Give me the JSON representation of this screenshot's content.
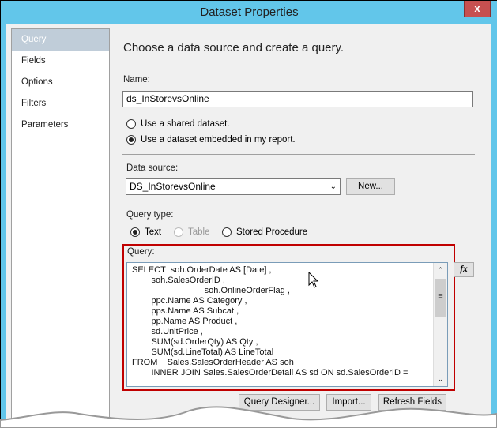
{
  "window": {
    "title": "Dataset Properties",
    "close_label": "x"
  },
  "nav": {
    "items": [
      {
        "label": "Query",
        "selected": true
      },
      {
        "label": "Fields"
      },
      {
        "label": "Options"
      },
      {
        "label": "Filters"
      },
      {
        "label": "Parameters"
      }
    ]
  },
  "main": {
    "heading": "Choose a data source and create a query.",
    "name_label": "Name:",
    "name_value": "ds_InStorevsOnline",
    "radio_shared": "Use a shared dataset.",
    "radio_embedded": "Use a dataset embedded in my report.",
    "datasource_label": "Data source:",
    "datasource_value": "DS_InStorevsOnline",
    "new_button": "New...",
    "query_type_label": "Query type:",
    "qt_text": "Text",
    "qt_table": "Table",
    "qt_sp": "Stored Procedure",
    "query_label": "Query:",
    "query_text": "SELECT  soh.OrderDate AS [Date] ,\n        soh.SalesOrderID ,\n                              soh.OnlineOrderFlag ,\n        ppc.Name AS Category ,\n        pps.Name AS Subcat ,\n        pp.Name AS Product ,\n        sd.UnitPrice ,\n        SUM(sd.OrderQty) AS Qty ,\n        SUM(sd.LineTotal) AS LineTotal\nFROM    Sales.SalesOrderHeader AS soh\n        INNER JOIN Sales.SalesOrderDetail AS sd ON sd.SalesOrderID =",
    "fx_button": "fx",
    "query_designer_button": "Query Designer...",
    "import_button": "Import...",
    "refresh_fields_button": "Refresh Fields"
  },
  "colors": {
    "titlebar": "#62c6ea",
    "highlight": "#c00000",
    "close": "#c75050"
  }
}
